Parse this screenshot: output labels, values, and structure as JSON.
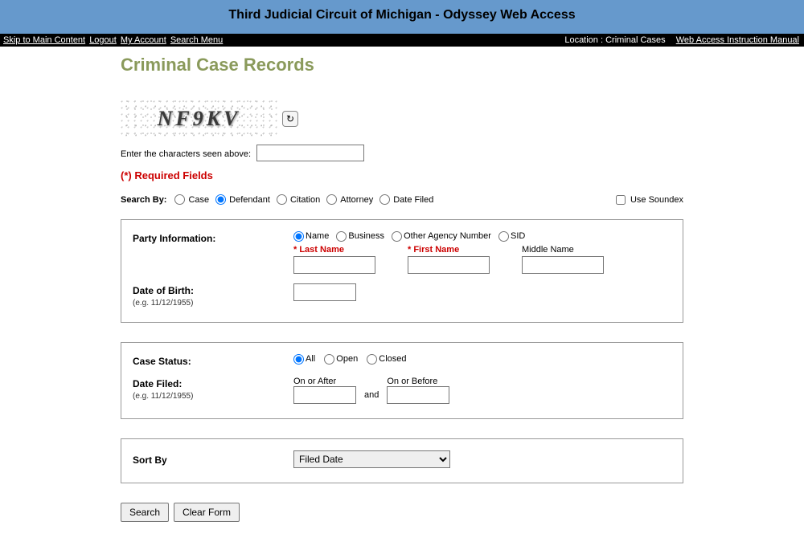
{
  "header": {
    "title": "Third Judicial Circuit of Michigan - Odyssey Web Access"
  },
  "nav": {
    "left": {
      "skip": "Skip to Main Content",
      "logout": "Logout",
      "account": "My Account",
      "search_menu": "Search Menu"
    },
    "right": {
      "location": "Location : Criminal Cases",
      "manual": "Web Access Instruction Manual"
    }
  },
  "page": {
    "title": "Criminal Case Records"
  },
  "captcha": {
    "text": "NF9KV",
    "label": "Enter the characters seen above:"
  },
  "required_note": "(*) Required Fields",
  "search_by": {
    "label": "Search By:",
    "options": {
      "case": "Case",
      "defendant": "Defendant",
      "citation": "Citation",
      "attorney": "Attorney",
      "date_filed": "Date Filed"
    }
  },
  "soundex_label": "Use Soundex",
  "party": {
    "section_label": "Party Information:",
    "radios": {
      "name": "Name",
      "business": "Business",
      "other_agency": "Other Agency Number",
      "sid": "SID"
    },
    "last_name_label": "* Last Name",
    "first_name_label": "* First Name",
    "middle_name_label": "Middle Name"
  },
  "dob": {
    "label": "Date of Birth:",
    "hint": "(e.g. 11/12/1955)"
  },
  "case_status": {
    "label": "Case Status:",
    "options": {
      "all": "All",
      "open": "Open",
      "closed": "Closed"
    }
  },
  "date_filed": {
    "label": "Date Filed:",
    "hint": "(e.g. 11/12/1955)",
    "on_after": "On or After",
    "on_before": "On or Before",
    "and": "and"
  },
  "sort": {
    "label": "Sort By",
    "selected": "Filed Date"
  },
  "buttons": {
    "search": "Search",
    "clear": "Clear Form"
  }
}
